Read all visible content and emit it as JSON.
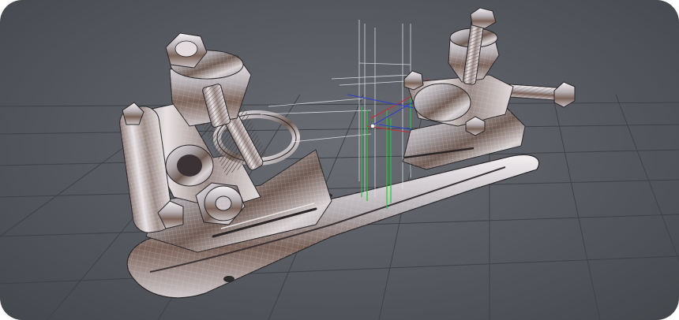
{
  "viewport": {
    "background": "#55595f",
    "grid_color": "#3f4348",
    "mesh_color": "#d9d9dc",
    "gizmo_colors": {
      "x": "#c0303a",
      "y": "#28c040",
      "z": "#3040c8",
      "guide": "#e8e8ea"
    }
  },
  "scene": {
    "objects": [
      {
        "name": "baseplate",
        "material": "chrome"
      },
      {
        "name": "front-truck",
        "material": "chrome"
      },
      {
        "name": "rear-truck",
        "material": "chrome"
      },
      {
        "name": "kingpin-bolt",
        "material": "chrome"
      },
      {
        "name": "axle",
        "material": "chrome"
      },
      {
        "name": "cushions",
        "material": "chrome"
      }
    ]
  }
}
